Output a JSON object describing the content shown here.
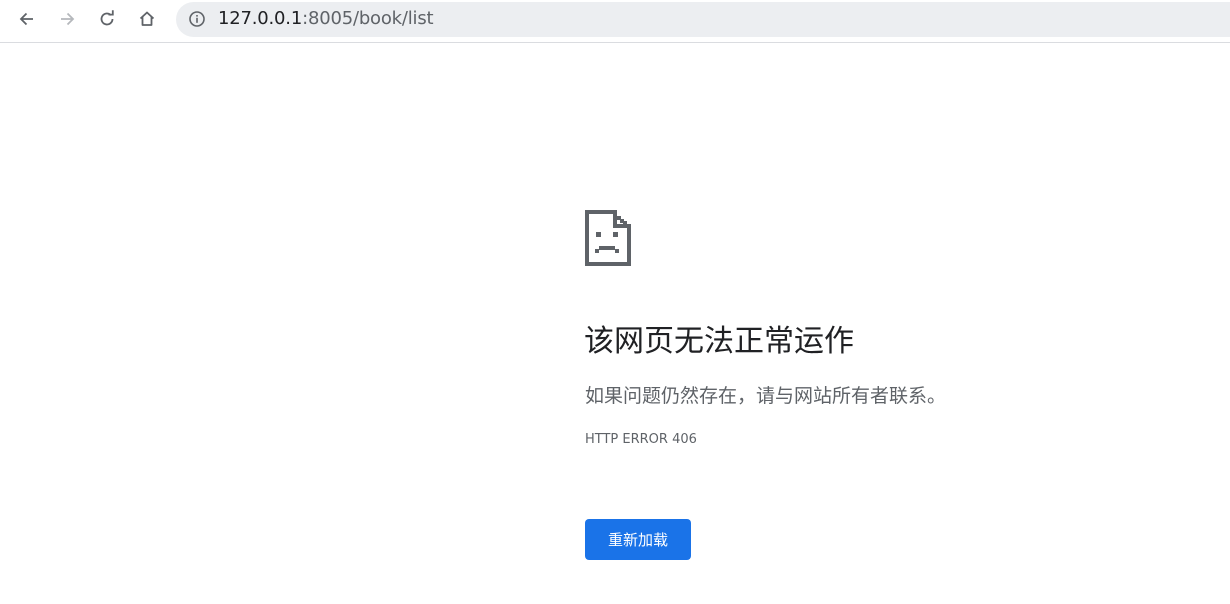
{
  "browser": {
    "url_host": "127.0.0.1",
    "url_rest": ":8005/book/list",
    "back_icon": "arrow-left-icon",
    "forward_icon": "arrow-right-icon",
    "reload_icon": "reload-icon",
    "home_icon": "home-icon",
    "info_icon": "info-icon"
  },
  "error_page": {
    "icon": "sad-document-icon",
    "title": "该网页无法正常运作",
    "message": "如果问题仍然存在，请与网站所有者联系。",
    "error_code": "HTTP ERROR 406",
    "reload_label": "重新加载",
    "accent_color": "#1a73e8"
  }
}
